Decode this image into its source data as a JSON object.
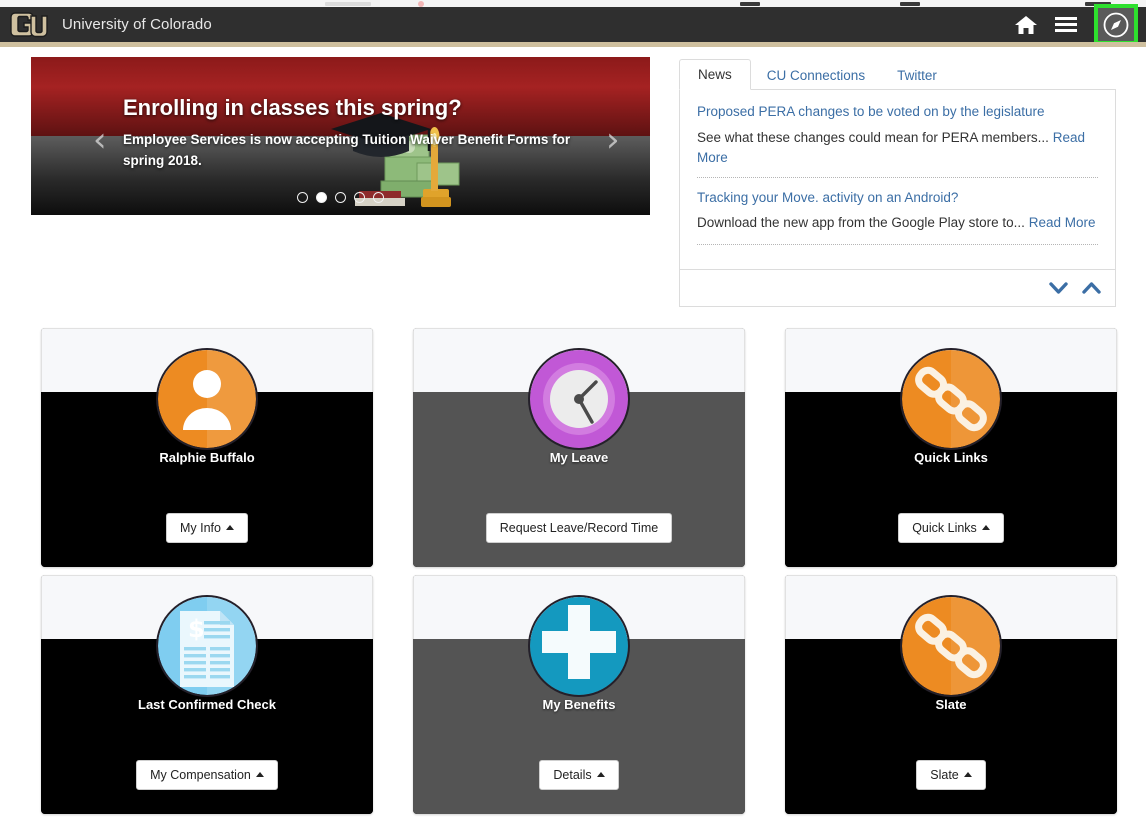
{
  "appbar": {
    "logo_icon": "cu-logo-icon",
    "title": "University of Colorado",
    "home_icon": "home-icon",
    "menu_icon": "hamburger-menu-icon",
    "nav_icon": "compass-navigator-icon",
    "bg_color": "#2f2f2f",
    "gold_color": "#cfc09f",
    "highlight_color": "#2ee02e"
  },
  "carousel": {
    "title": "Enrolling in classes this spring?",
    "subtitle": "Employee Services is now accepting Tuition Waiver Benefit Forms for spring 2018.",
    "prev_icon": "chevron-left-icon",
    "next_icon": "chevron-right-icon",
    "prev_glyph": "‹",
    "next_glyph": "›",
    "slide_count": 5,
    "active_slide": 2,
    "art_icon": "graduation-cap-and-money-icon",
    "top_color": "#a52222"
  },
  "news": {
    "tabs": [
      {
        "label": "News",
        "active": true
      },
      {
        "label": "CU Connections",
        "active": false
      },
      {
        "label": "Twitter",
        "active": false
      }
    ],
    "items": [
      {
        "headline": "Proposed PERA changes to be voted on by the legislature",
        "summary": "See what these changes could mean for PERA members...",
        "link_label": "Read More"
      },
      {
        "headline": "Tracking your Move. activity on an Android?",
        "summary": "Download the new app from the Google Play store to...",
        "link_label": "Read More"
      }
    ],
    "footer": {
      "down_icon": "chevron-down-icon",
      "up_icon": "chevron-up-icon"
    },
    "link_color": "#3b6ea5"
  },
  "tiles": [
    {
      "name": "my-info",
      "label": "Ralphie Buffalo",
      "button_label": "My Info",
      "has_caret": true,
      "body_style": "black",
      "icon_name": "user-avatar-icon",
      "icon_color": "#ed8b22"
    },
    {
      "name": "my-leave",
      "label": "My Leave",
      "button_label": "Request Leave/Record Time",
      "has_caret": false,
      "body_style": "gray",
      "icon_name": "clock-icon",
      "icon_color": "#c158d6"
    },
    {
      "name": "quick-links",
      "label": "Quick Links",
      "button_label": "Quick Links",
      "has_caret": true,
      "body_style": "black",
      "icon_name": "chain-link-icon",
      "icon_color": "#ed8b22"
    },
    {
      "name": "last-confirmed-check",
      "label": "Last Confirmed Check",
      "button_label": "My Compensation",
      "has_caret": true,
      "body_style": "black",
      "icon_name": "paycheck-document-icon",
      "icon_color": "#7fcdf0"
    },
    {
      "name": "my-benefits",
      "label": "My Benefits",
      "button_label": "Details",
      "has_caret": true,
      "body_style": "gray",
      "icon_name": "medical-cross-icon",
      "icon_color": "#1499bf"
    },
    {
      "name": "slate",
      "label": "Slate",
      "button_label": "Slate",
      "has_caret": true,
      "body_style": "black",
      "icon_name": "chain-link-icon",
      "icon_color": "#ed8b22"
    }
  ]
}
